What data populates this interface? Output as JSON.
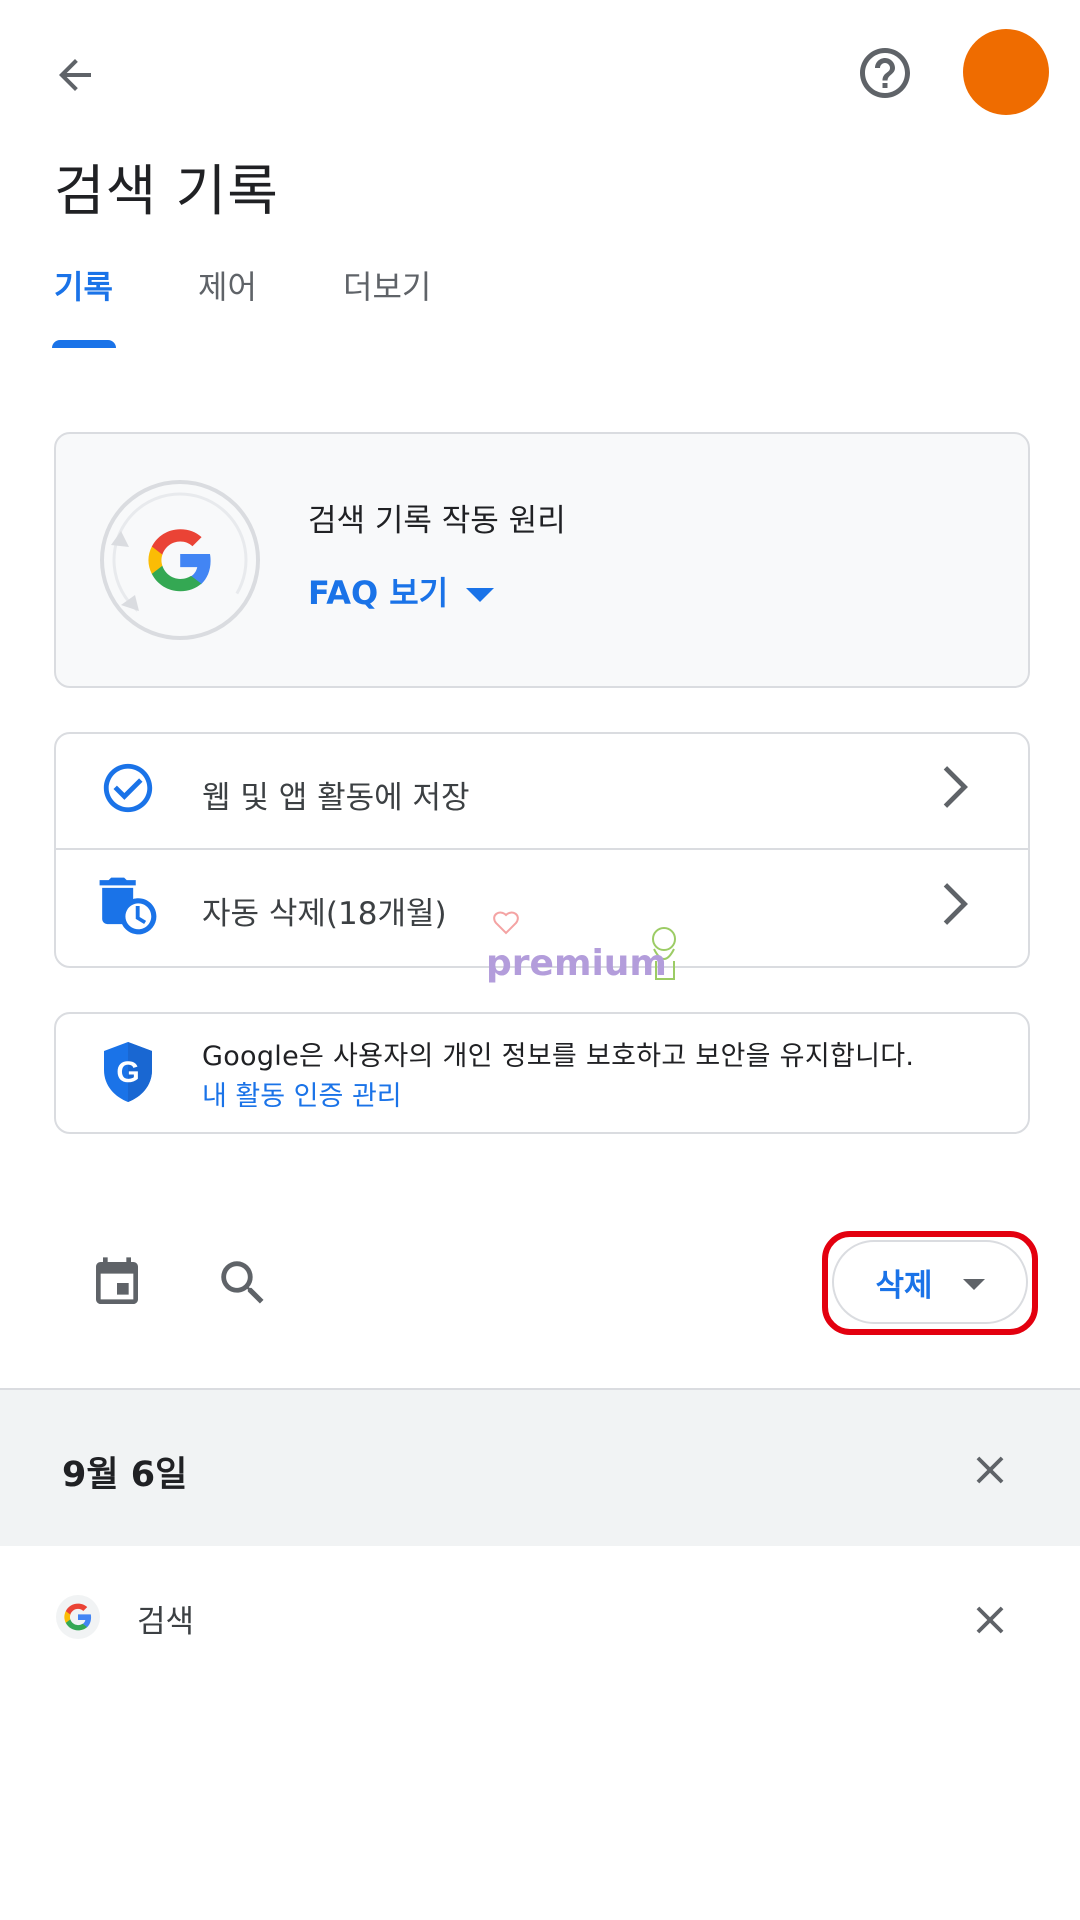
{
  "header": {
    "back_icon": "arrow-back-icon",
    "help_icon": "help-circle-icon",
    "avatar_color": "#ef6c00",
    "title": "검색 기록"
  },
  "tabs": [
    {
      "label": "기록",
      "active": true
    },
    {
      "label": "제어",
      "active": false
    },
    {
      "label": "더보기",
      "active": false
    }
  ],
  "faq_card": {
    "title": "검색 기록 작동 원리",
    "link": "FAQ 보기"
  },
  "settings": [
    {
      "label": "웹 및 앱 활동에 저장",
      "icon": "check-circle-icon"
    },
    {
      "label": "자동 삭제(18개월)",
      "icon": "auto-delete-icon"
    }
  ],
  "security": {
    "text": "Google은 사용자의 개인 정보를 보호하고 보안을 유지합니다.",
    "link": "내 활동 인증 관리"
  },
  "toolbar": {
    "calendar_icon": "calendar-icon",
    "search_icon": "search-icon",
    "delete_label": "삭제"
  },
  "history": {
    "date": "9월 6일",
    "items": [
      {
        "label": "검색",
        "icon": "google-g-icon"
      }
    ]
  },
  "watermark": {
    "text": "premium"
  },
  "colors": {
    "accent": "#1a73e8",
    "highlight": "#e3000f",
    "band": "#f1f3f4"
  }
}
